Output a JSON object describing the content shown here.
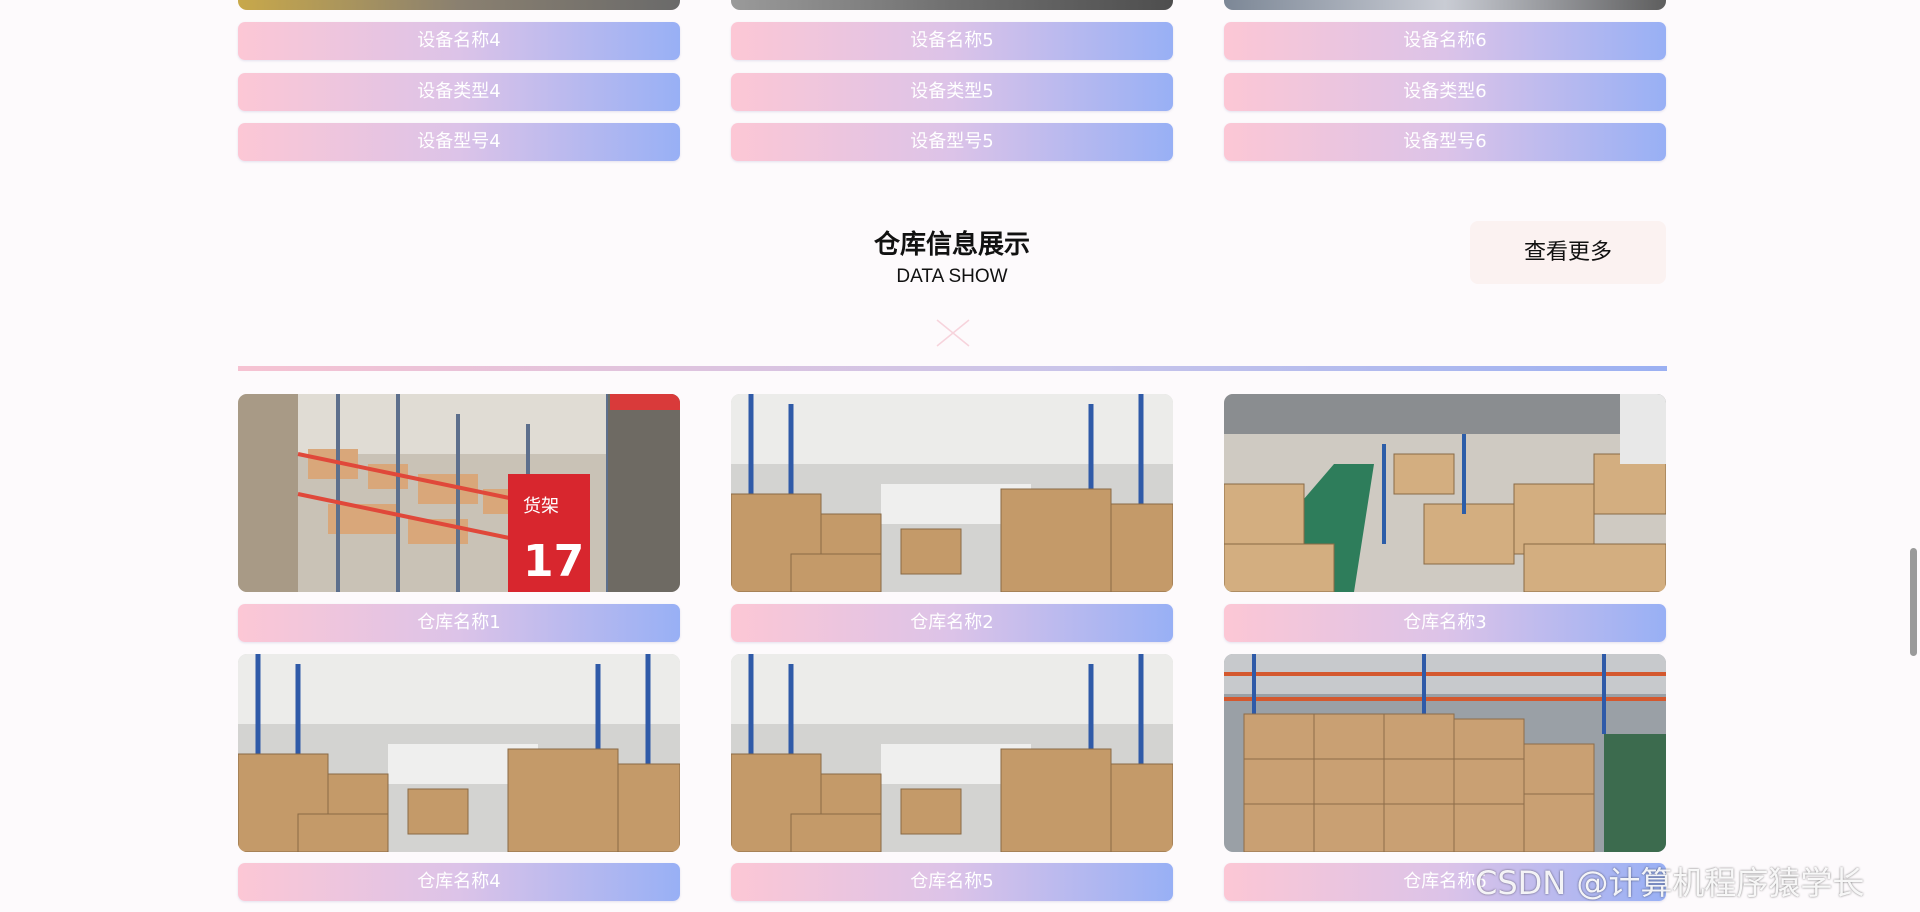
{
  "equipment": {
    "cards": [
      {
        "name": "设备名称4",
        "type": "设备类型4",
        "model": "设备型号4"
      },
      {
        "name": "设备名称5",
        "type": "设备类型5",
        "model": "设备型号5"
      },
      {
        "name": "设备名称6",
        "type": "设备类型6",
        "model": "设备型号6"
      }
    ]
  },
  "warehouse": {
    "title": "仓库信息展示",
    "subtitle": "DATA SHOW",
    "more_label": "查看更多",
    "items": [
      {
        "name": "仓库名称1"
      },
      {
        "name": "仓库名称2"
      },
      {
        "name": "仓库名称3"
      },
      {
        "name": "仓库名称4"
      },
      {
        "name": "仓库名称5"
      },
      {
        "name": "仓库名称6"
      }
    ]
  },
  "watermark": "CSDN @计算机程序猿学长",
  "colors": {
    "pill_gradient": [
      "#fcc7d5",
      "#dcc3e8",
      "#98b0f5"
    ],
    "more_button_bg": "#fbf2f1",
    "page_bg": "#fdfafc"
  },
  "icons": {
    "divider_decoration": "x-cross-icon"
  }
}
